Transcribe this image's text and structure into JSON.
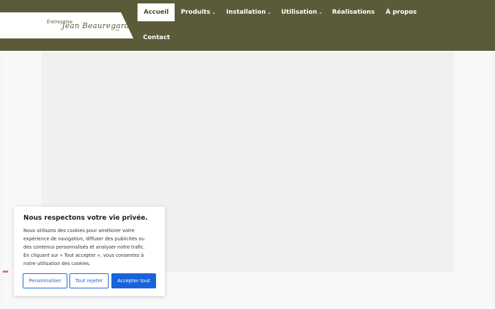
{
  "logo": {
    "line1": "Entreprise",
    "line2": "Jean Beauregard",
    "suffix": "inc."
  },
  "nav": {
    "items": [
      {
        "label": "Accueil",
        "active": true,
        "dropdown": false
      },
      {
        "label": "Produits",
        "active": false,
        "dropdown": true
      },
      {
        "label": "Installation",
        "active": false,
        "dropdown": true
      },
      {
        "label": "Utilisation",
        "active": false,
        "dropdown": true
      },
      {
        "label": "Réalisations",
        "active": false,
        "dropdown": false
      },
      {
        "label": "À propos",
        "active": false,
        "dropdown": false
      },
      {
        "label": "Contact",
        "active": false,
        "dropdown": false
      }
    ],
    "dropdown_icon": "chevron-down-icon"
  },
  "cookie": {
    "title": "Nous respectons votre vie privée.",
    "lines": [
      "Nous utilisons des cookies pour améliorer votre",
      "expérience de navigation, diffuser des publicités ou",
      "des contenus personnalisés et analyser notre trafic.",
      "En cliquant sur « Tout accepter », vous consentez à",
      "notre utilisation des cookies."
    ],
    "customize_label": "Personnaliser",
    "reject_label": "Tout rejeter",
    "accept_label": "Accepter tout"
  },
  "colors": {
    "header_bg": "#5b5b3a",
    "accent_blue": "#1863dc",
    "marker": "#e8785a"
  }
}
